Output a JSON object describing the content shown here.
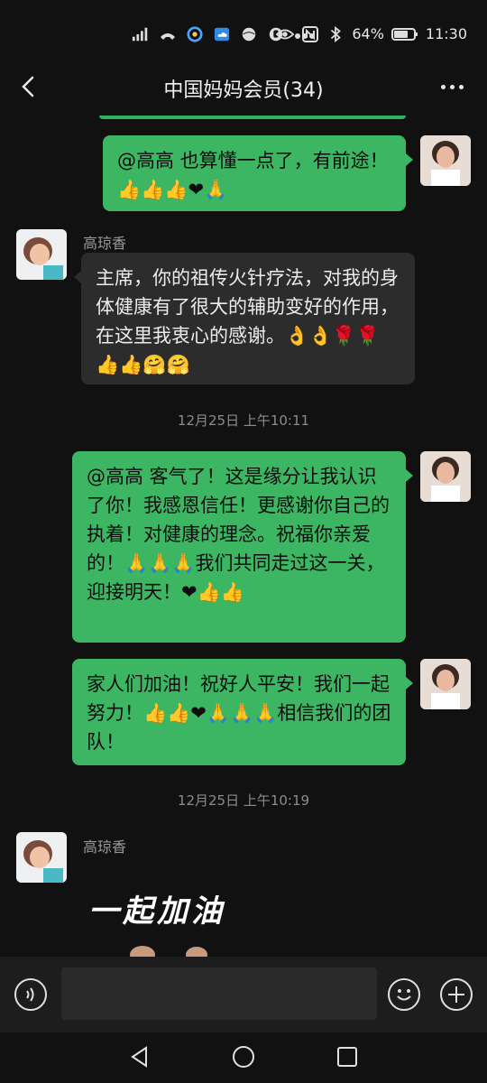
{
  "status": {
    "battery": "64%",
    "time": "11:30"
  },
  "header": {
    "title": "中国妈妈会员(34)"
  },
  "messages": [
    {
      "sender": "",
      "text": "@高高  也算懂一点了，有前途！👍👍👍❤🙏"
    },
    {
      "sender": "高琼香",
      "text": "主席，你的祖传火针疗法，对我的身体健康有了很大的辅助变好的作用，在这里我衷心的感谢。👌👌🌹🌹👍👍🤗🤗"
    },
    {
      "sender": "",
      "text": "@高高  客气了！这是缘分让我认识了你！我感恩信任！更感谢你自己的执着！对健康的理念。祝福你亲爱的！🙏🙏🙏我们共同走过这一关，迎接明天！❤👍👍"
    },
    {
      "sender": "",
      "text": "家人们加油！祝好人平安！我们一起努力！👍👍❤🙏🙏🙏相信我们的团队！"
    },
    {
      "sender": "高琼香",
      "sticker_text": "一起加油"
    }
  ],
  "timestamps": [
    "12月25日 上午10:11",
    "12月25日 上午10:19"
  ],
  "sender_name": "高琼香",
  "colors": {
    "self_bubble": "#3cb662",
    "other_bubble": "#2c2c2c",
    "background": "#111111"
  }
}
